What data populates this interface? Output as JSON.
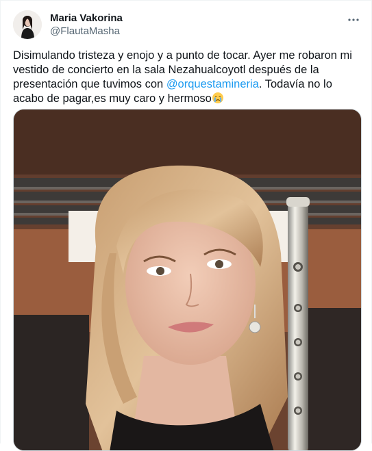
{
  "tweet": {
    "display_name": "Maria Vakorina",
    "handle": "@FlautaMasha",
    "text_before": "Disimulando tristeza y enojo y a punto de tocar. Ayer me robaron mi vestido de concierto en la sala Nezahualcoyotl después de la presentación que tuvimos con ",
    "mention": "@orquestamineria",
    "text_after": ". Todavía no lo acabo de pagar,es muy caro y hermoso",
    "emoji_icon": "crying-face-emoji",
    "more_icon": "more-horizontal-icon",
    "media_alt": "Selfie of a blonde woman holding a silver flute in a concert hall with wooden seats"
  },
  "colors": {
    "text": "#0f1419",
    "secondary": "#536471",
    "link": "#1d9bf0",
    "border": "#cfd9de"
  }
}
